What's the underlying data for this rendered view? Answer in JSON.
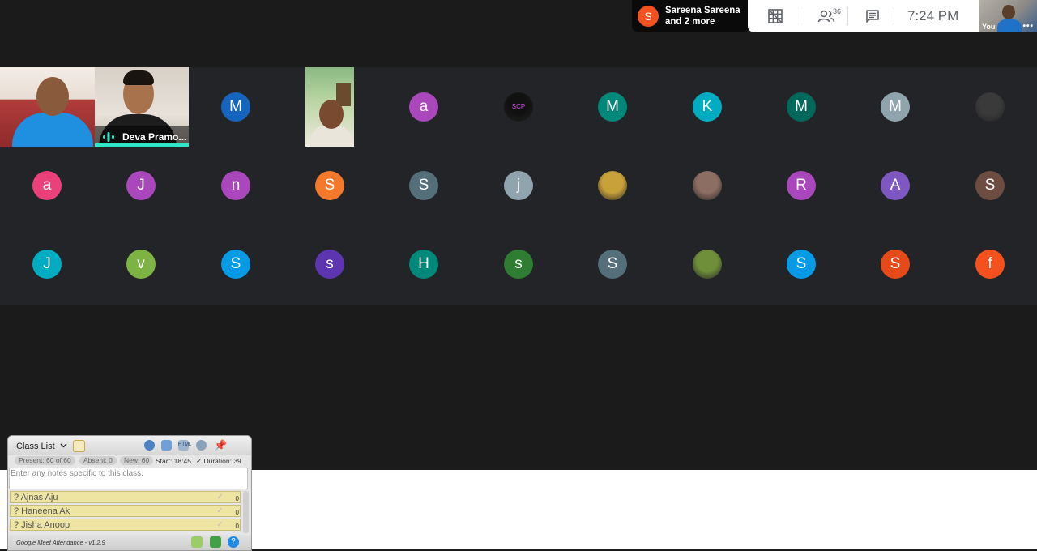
{
  "presenting": {
    "initial": "S",
    "line1": "Sareena Sareena",
    "line2": "and 2 more"
  },
  "toolbar": {
    "participant_count": "36",
    "time": "7:24 PM"
  },
  "self_tile": {
    "label": "You",
    "menu": "•••"
  },
  "video_tiles": {
    "speaker_name": "Deva Pramo..."
  },
  "participants": [
    {
      "initial": "M",
      "color": "#1565c0",
      "photo": false
    },
    {
      "initial": "a",
      "color": "#ab47bc",
      "photo": false
    },
    {
      "initial": "SCP",
      "color": "#111111",
      "photo": true
    },
    {
      "initial": "M",
      "color": "#00897b",
      "photo": false
    },
    {
      "initial": "K",
      "color": "#00acc1",
      "photo": false
    },
    {
      "initial": "M",
      "color": "#00695c",
      "photo": false
    },
    {
      "initial": "M",
      "color": "#90a4ae",
      "photo": false
    },
    {
      "initial": "",
      "color": "#3a3a3a",
      "photo": true
    },
    {
      "initial": "a",
      "color": "#ec407a",
      "photo": false
    },
    {
      "initial": "J",
      "color": "#ab47bc",
      "photo": false
    },
    {
      "initial": "n",
      "color": "#ab47bc",
      "photo": false
    },
    {
      "initial": "S",
      "color": "#f4792b",
      "photo": false
    },
    {
      "initial": "S",
      "color": "#546e7a",
      "photo": false
    },
    {
      "initial": "j",
      "color": "#90a4ae",
      "photo": false
    },
    {
      "initial": "",
      "color": "#c9a13a",
      "photo": true
    },
    {
      "initial": "",
      "color": "#8d6e63",
      "photo": true
    },
    {
      "initial": "R",
      "color": "#ab47bc",
      "photo": false
    },
    {
      "initial": "A",
      "color": "#7e57c2",
      "photo": false
    },
    {
      "initial": "S",
      "color": "#6d4c41",
      "photo": false
    },
    {
      "initial": "J",
      "color": "#00acc1",
      "photo": false
    },
    {
      "initial": "v",
      "color": "#7cb342",
      "photo": false
    },
    {
      "initial": "S",
      "color": "#039be5",
      "photo": false
    },
    {
      "initial": "s",
      "color": "#5e35b1",
      "photo": false
    },
    {
      "initial": "H",
      "color": "#00897b",
      "photo": false
    },
    {
      "initial": "s",
      "color": "#2e7d32",
      "photo": false
    },
    {
      "initial": "S",
      "color": "#546e7a",
      "photo": false
    },
    {
      "initial": "",
      "color": "#6f8f3a",
      "photo": true
    },
    {
      "initial": "S",
      "color": "#039be5",
      "photo": false
    },
    {
      "initial": "S",
      "color": "#e64a19",
      "photo": false
    },
    {
      "initial": "f",
      "color": "#f4511e",
      "photo": false
    }
  ],
  "attendance": {
    "title": "Class List",
    "present": "Present: 60 of 60",
    "absent": "Absent: 0",
    "new": "New: 60",
    "start": "Start: 18:45",
    "duration": "✓ Duration: 39",
    "notes_placeholder": "Enter any notes specific to this class.",
    "students": [
      {
        "name": "? Ajnas Aju",
        "count": "0"
      },
      {
        "name": "? Haneena Ak",
        "count": "0"
      },
      {
        "name": "? Jisha Anoop",
        "count": "0"
      }
    ],
    "version": "Google Meet Attendance - v1.2.9"
  }
}
